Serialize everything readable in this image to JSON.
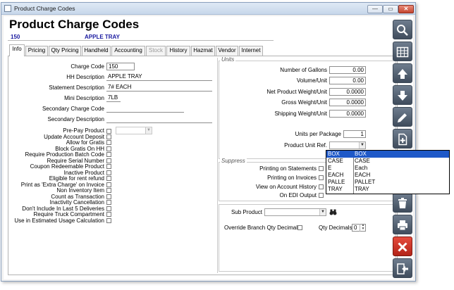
{
  "window": {
    "title": "Product Charge Codes",
    "controls": {
      "minimize": "—",
      "maximize": "▭",
      "close": "✕"
    }
  },
  "header": {
    "title": "Product Charge Codes",
    "code": "150",
    "description": "APPLE TRAY"
  },
  "tabs": [
    {
      "label": "Info",
      "active": true,
      "enabled": true
    },
    {
      "label": "Pricing",
      "active": false,
      "enabled": true
    },
    {
      "label": "Qty Pricing",
      "active": false,
      "enabled": true
    },
    {
      "label": "Handheld",
      "active": false,
      "enabled": true
    },
    {
      "label": "Accounting",
      "active": false,
      "enabled": true
    },
    {
      "label": "Stock",
      "active": false,
      "enabled": false
    },
    {
      "label": "History",
      "active": false,
      "enabled": true
    },
    {
      "label": "Hazmat",
      "active": false,
      "enabled": true
    },
    {
      "label": "Vendor",
      "active": false,
      "enabled": true
    },
    {
      "label": "Internet",
      "active": false,
      "enabled": true
    }
  ],
  "info": {
    "charge_code": {
      "label": "Charge Code",
      "value": "150"
    },
    "hh_description": {
      "label": "HH Description",
      "value": "APPLE TRAY"
    },
    "statement_description": {
      "label": "Statement Description",
      "value": "7# EACH"
    },
    "mini_description": {
      "label": "Mini Description",
      "value": "7LB"
    },
    "secondary_charge_code": {
      "label": "Secondary Charge Code",
      "value": ""
    },
    "secondary_description": {
      "label": "Secondary Description",
      "value": ""
    }
  },
  "checkboxes": [
    {
      "label": "Pre-Pay Product",
      "checked": false
    },
    {
      "label": "Update Account Deposit",
      "checked": false
    },
    {
      "label": "Allow for Gratis",
      "checked": false
    },
    {
      "label": "Block Gratis On HH",
      "checked": false
    },
    {
      "label": "Require Production Batch Code",
      "checked": false
    },
    {
      "label": "Require Serial Number",
      "checked": false
    },
    {
      "label": "Coupon Redeemable Product",
      "checked": false
    },
    {
      "label": "Inactive Product",
      "checked": false
    },
    {
      "label": "Eligible for rent refund",
      "checked": false
    },
    {
      "label": "Print as 'Extra Charge' on Invoice",
      "checked": false
    },
    {
      "label": "Non Inventory Item",
      "checked": false
    },
    {
      "label": "Count as Transaction",
      "checked": false
    },
    {
      "label": "Inactivity Cancellation",
      "checked": false
    },
    {
      "label": "Don't Include In Last 5 Deliveries",
      "checked": false
    },
    {
      "label": "Require Truck Compartment",
      "checked": false
    },
    {
      "label": "Use in Estimated Usage Calculation",
      "checked": false
    }
  ],
  "units": {
    "group_title": "Units",
    "fields": [
      {
        "label": "Number of Gallons",
        "value": "0.00"
      },
      {
        "label": "Volume/Unit",
        "value": "0.00"
      },
      {
        "label": "Net Product Weight/Unit",
        "value": "0.0000"
      },
      {
        "label": "Gross Weight/Unit",
        "value": "0.0000"
      },
      {
        "label": "Shipping Weight/Unit",
        "value": "0.0000"
      }
    ],
    "units_per_package": {
      "label": "Units per Package",
      "value": "1"
    },
    "product_unit_ref": {
      "label": "Product Unit Ref.",
      "value": ""
    }
  },
  "unit_dropdown": {
    "options": [
      {
        "code": "BOX",
        "name": "BOX",
        "selected": true
      },
      {
        "code": "CASE",
        "name": "CASE",
        "selected": false
      },
      {
        "code": "E",
        "name": "Each",
        "selected": false
      },
      {
        "code": "EACH",
        "name": "EACH",
        "selected": false
      },
      {
        "code": "PALLE",
        "name": "PALLET",
        "selected": false
      },
      {
        "code": "TRAY",
        "name": "TRAY",
        "selected": false
      }
    ]
  },
  "suppress": {
    "group_title": "Suppress",
    "items": [
      {
        "label": "Printing on Statements",
        "checked": false
      },
      {
        "label": "Printing on Invoices",
        "checked": false
      },
      {
        "label": "View on Account History",
        "checked": false
      },
      {
        "label": "On EDI Output",
        "checked": false
      }
    ]
  },
  "sub_product": {
    "label": "Sub Product",
    "value": ""
  },
  "override_branch_qty_decimals": {
    "label": "Override Branch Qty Decimals",
    "checked": false
  },
  "qty_decimals": {
    "label": "Qty Decimals",
    "value": "0"
  },
  "toolbar": [
    {
      "icon": "search-icon"
    },
    {
      "icon": "grid-icon"
    },
    {
      "icon": "arrow-up-icon"
    },
    {
      "icon": "arrow-down-icon"
    },
    {
      "icon": "pencil-icon"
    },
    {
      "icon": "new-document-icon"
    },
    {
      "icon": "trash-icon"
    },
    {
      "icon": "printer-icon"
    },
    {
      "icon": "cancel-icon"
    },
    {
      "icon": "exit-icon"
    }
  ],
  "colors": {
    "accent_blue": "#1a1aa0",
    "selection": "#1f59c8",
    "toolbar": "#4f5c6c",
    "cancel_red": "#c9301f"
  }
}
